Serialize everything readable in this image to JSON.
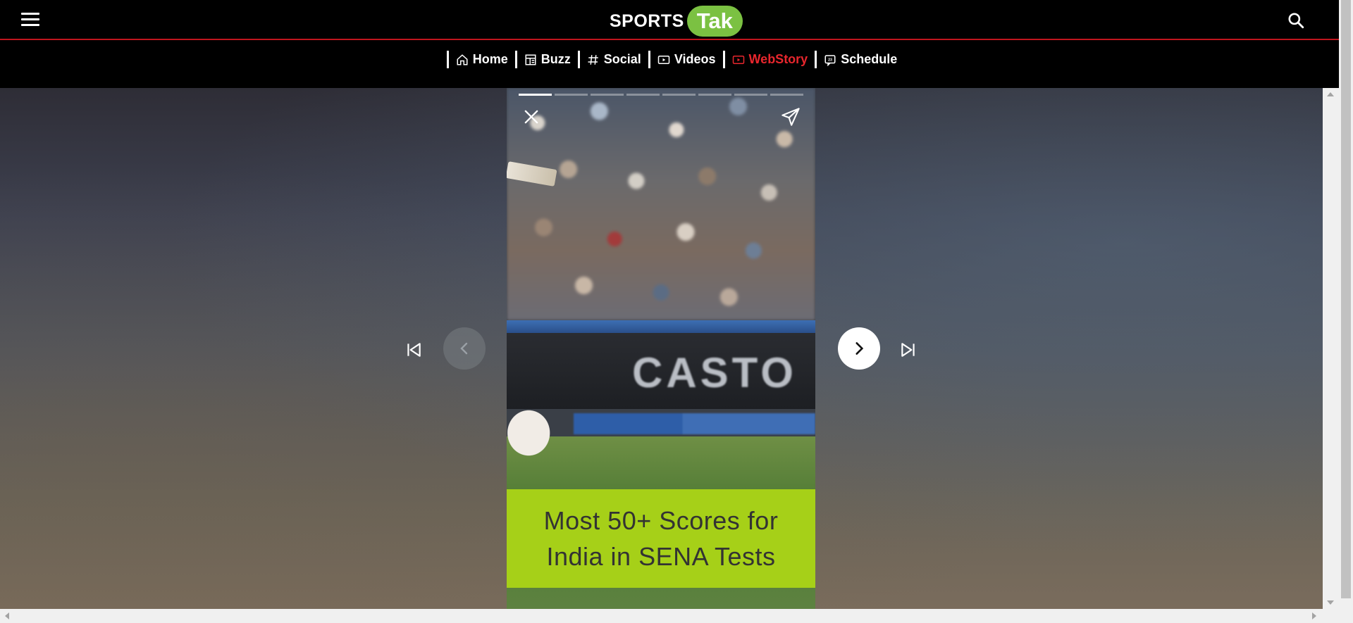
{
  "header": {
    "logo_left": "SPORTS",
    "logo_right": "Tak",
    "menu_icon": "hamburger-menu-icon",
    "search_icon": "search-icon"
  },
  "nav": {
    "items": [
      {
        "label": "Home",
        "icon": "home-icon",
        "active": false
      },
      {
        "label": "Buzz",
        "icon": "newspaper-icon",
        "active": false
      },
      {
        "label": "Social",
        "icon": "hashtag-icon",
        "active": false
      },
      {
        "label": "Videos",
        "icon": "video-play-icon",
        "active": false
      },
      {
        "label": "WebStory",
        "icon": "web-story-icon",
        "active": true
      },
      {
        "label": "Schedule",
        "icon": "calendar-icon",
        "active": false
      }
    ],
    "active_color": "#e8262d"
  },
  "story": {
    "board_text": "CASTO",
    "caption": "Most 50+ Scores for India in SENA Tests",
    "caption_bg": "#a6d018",
    "progress_segments": 8,
    "current_segment": 1
  },
  "controls": {
    "first": "skip-to-first-icon",
    "prev": "previous-arrow-icon",
    "next": "next-arrow-icon",
    "last": "skip-to-last-icon",
    "close": "close-icon",
    "share": "share-send-icon"
  },
  "colors": {
    "brand_green": "#7bc142",
    "header_border": "#c0151d"
  }
}
